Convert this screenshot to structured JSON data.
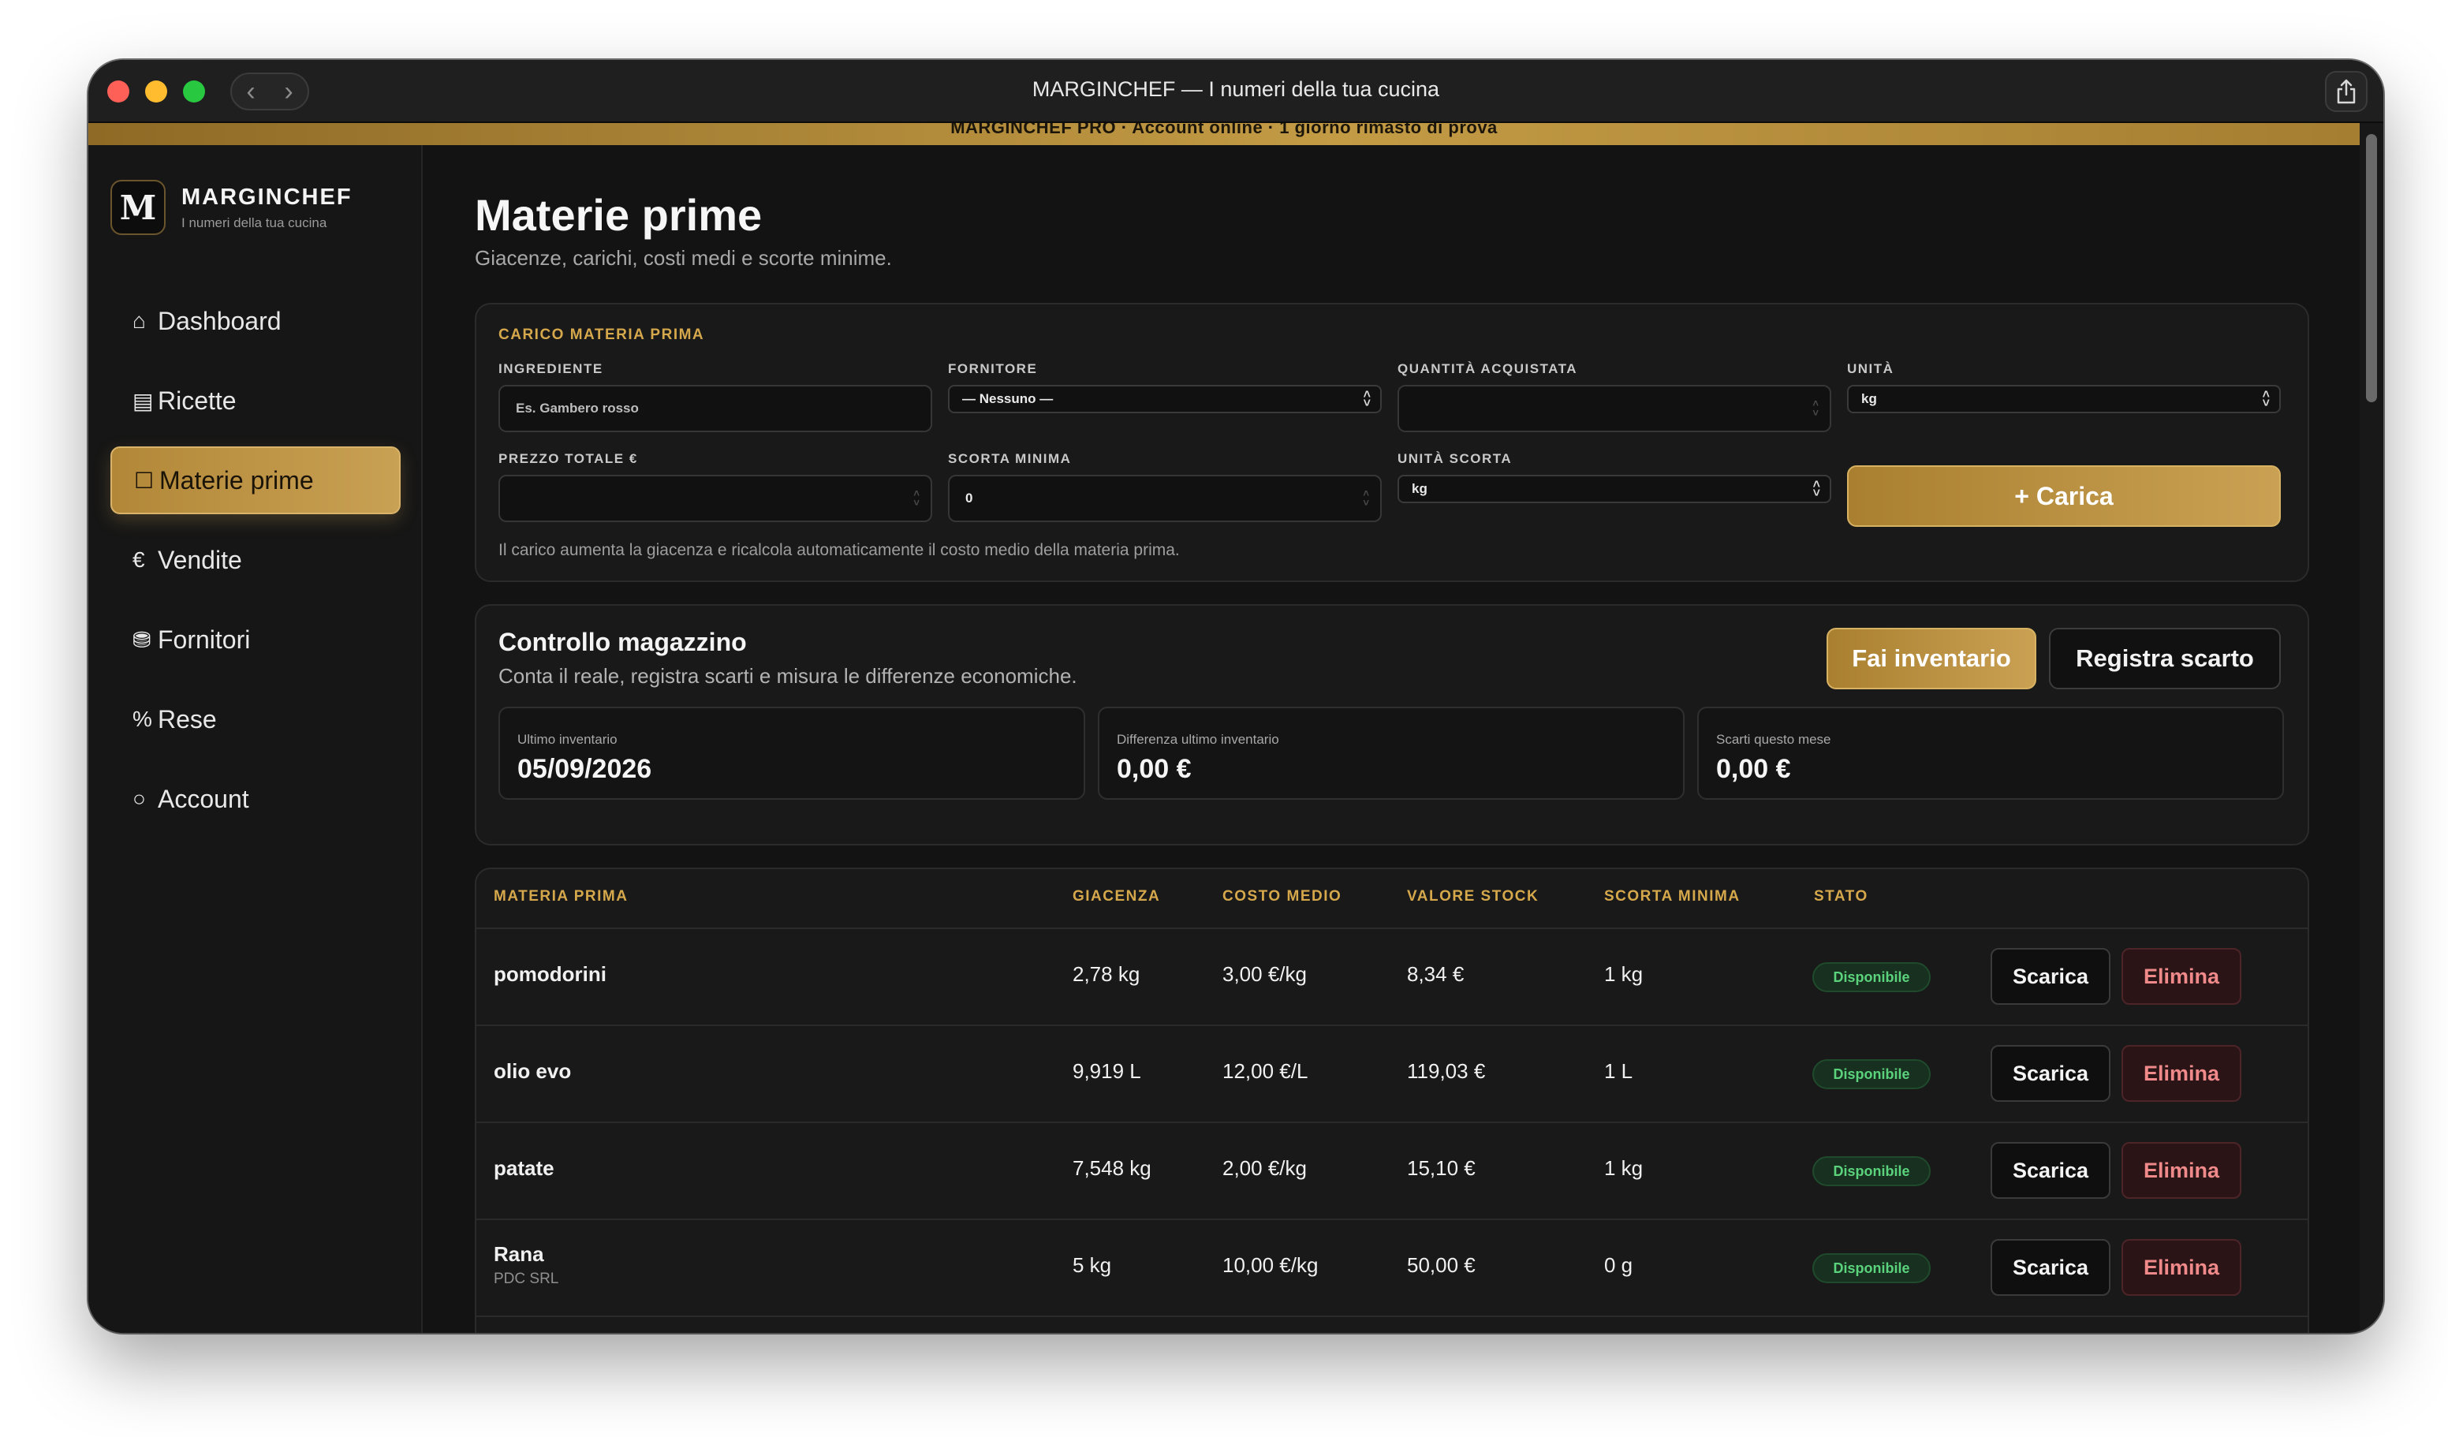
{
  "window": {
    "title": "MARGINCHEF — I numeri della tua cucina",
    "nav_back": "‹",
    "nav_forward": "›"
  },
  "banner": {
    "text": "MARGINCHEF PRO · Account online · 1 giorno rimasto di prova"
  },
  "brand": {
    "logo_letter": "M",
    "name": "MARGINCHEF",
    "tagline": "I numeri della tua cucina"
  },
  "sidebar": {
    "items": [
      {
        "glyph": "⌂",
        "label": "Dashboard",
        "icon": "home-icon"
      },
      {
        "glyph": "▤",
        "label": "Ricette",
        "icon": "book-icon"
      },
      {
        "glyph": "☐",
        "label": "Materie prime",
        "icon": "box-icon",
        "active": true
      },
      {
        "glyph": "€",
        "label": "Vendite",
        "icon": "euro-icon"
      },
      {
        "glyph": "⛃",
        "label": "Fornitori",
        "icon": "truck-icon"
      },
      {
        "glyph": "%",
        "label": "Rese",
        "icon": "percent-icon"
      },
      {
        "glyph": "○",
        "label": "Account",
        "icon": "circle-icon"
      }
    ]
  },
  "page": {
    "title": "Materie prime",
    "subtitle": "Giacenze, carichi, costi medi e scorte minime."
  },
  "load_form": {
    "section_title": "CARICO MATERIA PRIMA",
    "ingredient_label": "INGREDIENTE",
    "ingredient_placeholder": "Es. Gambero rosso",
    "supplier_label": "FORNITORE",
    "supplier_value": "— Nessuno —",
    "quantity_label": "QUANTITÀ ACQUISTATA",
    "quantity_value": "",
    "unit_label": "UNITÀ",
    "unit_value": "kg",
    "price_label": "PREZZO TOTALE €",
    "price_value": "",
    "min_stock_label": "SCORTA MINIMA",
    "min_stock_value": "0",
    "min_stock_unit_label": "UNITÀ SCORTA",
    "min_stock_unit_value": "kg",
    "submit_label": "+ Carica",
    "hint": "Il carico aumenta la giacenza e ricalcola automaticamente il costo medio della materia prima."
  },
  "inventory": {
    "title": "Controllo magazzino",
    "subtitle": "Conta il reale, registra scarti e misura le differenze economiche.",
    "inventory_button": "Fai inventario",
    "waste_button": "Registra scarto",
    "stats": [
      {
        "label": "Ultimo inventario",
        "value": "05/09/2026"
      },
      {
        "label": "Differenza ultimo inventario",
        "value": "0,00 €"
      },
      {
        "label": "Scarti questo mese",
        "value": "0,00 €"
      }
    ]
  },
  "table": {
    "columns": [
      "MATERIA PRIMA",
      "GIACENZA",
      "COSTO MEDIO",
      "VALORE STOCK",
      "SCORTA MINIMA",
      "STATO"
    ],
    "unload_label": "Scarica",
    "delete_label": "Elimina",
    "rows": [
      {
        "name": "pomodorini",
        "supplier": "",
        "stock": "2,78 kg",
        "avg_cost": "3,00 €/kg",
        "value": "8,34 €",
        "min": "1 kg",
        "status": "Disponibile"
      },
      {
        "name": "olio evo",
        "supplier": "",
        "stock": "9,919 L",
        "avg_cost": "12,00 €/L",
        "value": "119,03 €",
        "min": "1 L",
        "status": "Disponibile"
      },
      {
        "name": "patate",
        "supplier": "",
        "stock": "7,548 kg",
        "avg_cost": "2,00 €/kg",
        "value": "15,10 €",
        "min": "1 kg",
        "status": "Disponibile"
      },
      {
        "name": "Rana",
        "supplier": "PDC SRL",
        "stock": "5 kg",
        "avg_cost": "10,00 €/kg",
        "value": "50,00 €",
        "min": "0 g",
        "status": "Disponibile"
      }
    ]
  },
  "colors": {
    "accent": "#c9a154",
    "background": "#131313",
    "success": "#5bd37d",
    "danger": "#f08a8a"
  }
}
